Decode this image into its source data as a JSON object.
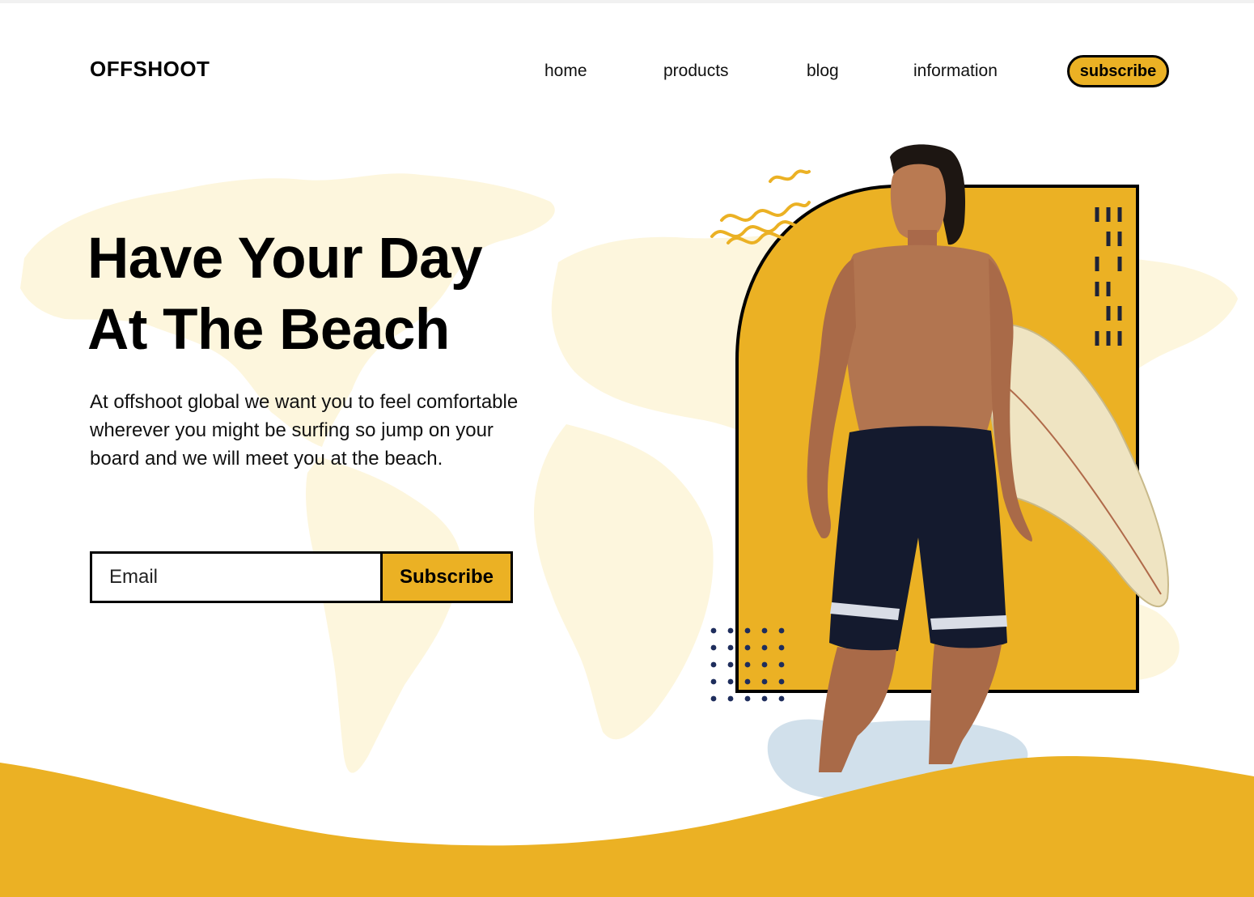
{
  "brand": {
    "logo_text": "OFFSHOOT"
  },
  "nav": {
    "links": [
      "home",
      "products",
      "blog",
      "information"
    ],
    "subscribe_label": "subscribe"
  },
  "hero": {
    "headline_line1": "Have Your Day",
    "headline_line2": "At The Beach",
    "description": "At offshoot global we want you to feel comfortable wherever you might be surfing so jump on your board and we will meet you at the beach.",
    "email_placeholder": "Email",
    "subscribe_button_label": "Subscribe"
  },
  "colors": {
    "accent": "#ebb124",
    "map": "#fdf6dd",
    "dots": "#1e2d5c",
    "text": "#000000"
  },
  "image": {
    "subject": "surfer-photo"
  }
}
